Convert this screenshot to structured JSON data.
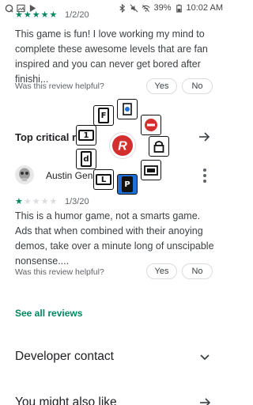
{
  "status_bar": {
    "battery_percent": "39%",
    "time": "10:02 AM"
  },
  "review1": {
    "rating": 5,
    "date": "1/2/20",
    "text": "This game is fun! I love working my mind to complete these awesome levels that are fan inspired and you can never get bored after finishi...",
    "helpful_prompt": "Was this review helpful?",
    "yes_label": "Yes",
    "no_label": "No"
  },
  "critical": {
    "title": "Top critical rev"
  },
  "review2": {
    "author": "Austin Gens",
    "rating": 1,
    "date": "1/3/20",
    "text": "This is a humor game, not a smarts game. Ads that when combined with their anoying demos, take over a minute long of unscipable nonsense....",
    "helpful_prompt": "Was this review helpful?",
    "yes_label": "Yes",
    "no_label": "No"
  },
  "see_all_label": "See all reviews",
  "developer_contact_label": "Developer contact",
  "you_might_label": "You might also like",
  "launcher": {
    "tiles": [
      {
        "name": "f-tile",
        "letter": "F"
      },
      {
        "name": "brightness-tile",
        "letter": ""
      },
      {
        "name": "no-entry-tile",
        "letter": ""
      },
      {
        "name": "one-tile",
        "letter": "1"
      },
      {
        "name": "lock-tile",
        "letter": ""
      },
      {
        "name": "d-tile",
        "letter": "d"
      },
      {
        "name": "tablet-tile",
        "letter": ""
      },
      {
        "name": "l-tile",
        "letter": "L"
      },
      {
        "name": "p-tile",
        "letter": "P"
      }
    ],
    "accent": "#1e6fd6",
    "logo_color": "#d32f2f"
  },
  "colors": {
    "accent_green": "#01875f",
    "text": "#202124",
    "secondary": "#5f6368"
  }
}
